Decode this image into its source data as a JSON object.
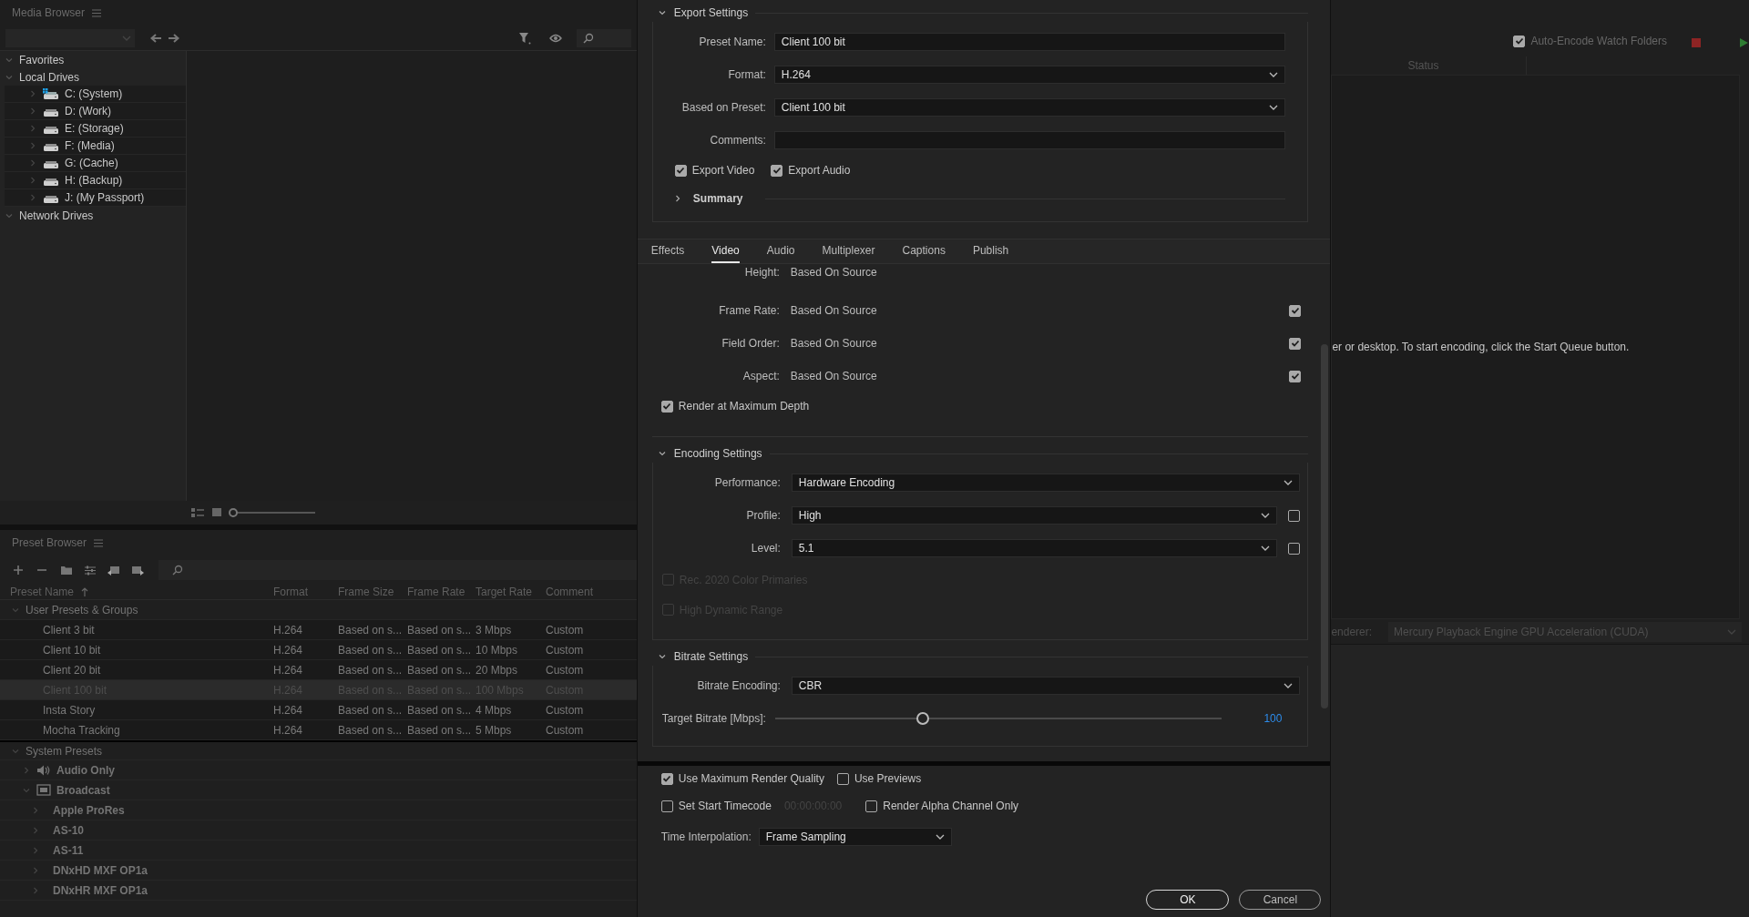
{
  "media_browser": {
    "title": "Media Browser",
    "zoom_slider": {
      "level": 0
    },
    "tree": [
      {
        "label": "Favorites",
        "expanded": true
      },
      {
        "label": "Local Drives",
        "expanded": true,
        "children": [
          {
            "label": "C: (System)",
            "kind": "system",
            "expanded": false
          },
          {
            "label": "D: (Work)",
            "kind": "drive",
            "expanded": false
          },
          {
            "label": "E: (Storage)",
            "kind": "drive",
            "expanded": false
          },
          {
            "label": "F: (Media)",
            "kind": "drive",
            "expanded": false
          },
          {
            "label": "G: (Cache)",
            "kind": "drive",
            "expanded": false
          },
          {
            "label": "H: (Backup)",
            "kind": "drive",
            "expanded": false
          },
          {
            "label": "J: (My Passport)",
            "kind": "drive",
            "expanded": false
          }
        ]
      },
      {
        "label": "Network Drives",
        "expanded": true
      }
    ]
  },
  "preset_browser": {
    "title": "Preset Browser",
    "columns": [
      {
        "label": "Preset Name",
        "sorted": true
      },
      {
        "label": "Format",
        "sorted": false
      },
      {
        "label": "Frame Size",
        "sorted": false
      },
      {
        "label": "Frame Rate",
        "sorted": false
      },
      {
        "label": "Target Rate",
        "sorted": false
      },
      {
        "label": "Comment",
        "sorted": false
      }
    ],
    "user_group": {
      "label": "User Presets & Groups",
      "expanded": true,
      "rows": [
        {
          "name": "Client 3 bit",
          "format": "H.264",
          "frame_size": "Based on s...",
          "frame_rate": "Based on s...",
          "target_rate": "3 Mbps",
          "comment": "Custom",
          "selected": false
        },
        {
          "name": "Client 10 bit",
          "format": "H.264",
          "frame_size": "Based on s...",
          "frame_rate": "Based on s...",
          "target_rate": "10 Mbps",
          "comment": "Custom",
          "selected": false
        },
        {
          "name": "Client 20 bit",
          "format": "H.264",
          "frame_size": "Based on s...",
          "frame_rate": "Based on s...",
          "target_rate": "20 Mbps",
          "comment": "Custom",
          "selected": false
        },
        {
          "name": "Client 100 bit",
          "format": "H.264",
          "frame_size": "Based on s...",
          "frame_rate": "Based on s...",
          "target_rate": "100 Mbps",
          "comment": "Custom",
          "selected": true
        },
        {
          "name": "Insta Story",
          "format": "H.264",
          "frame_size": "Based on s...",
          "frame_rate": "Based on s...",
          "target_rate": "4 Mbps",
          "comment": "Custom",
          "selected": false
        },
        {
          "name": "Mocha Tracking",
          "format": "H.264",
          "frame_size": "Based on s...",
          "frame_rate": "Based on s...",
          "target_rate": "5 Mbps",
          "comment": "Custom",
          "selected": false
        }
      ]
    },
    "system_group": {
      "label": "System Presets",
      "expanded": true,
      "children": [
        {
          "label": "Audio Only",
          "kind": "audio",
          "expanded": false
        },
        {
          "label": "Broadcast",
          "kind": "tv",
          "expanded": true,
          "children": [
            {
              "label": "Apple ProRes",
              "expanded": false
            },
            {
              "label": "AS-10",
              "expanded": false
            },
            {
              "label": "AS-11",
              "expanded": false
            },
            {
              "label": "DNxHD MXF OP1a",
              "expanded": false
            },
            {
              "label": "DNxHR MXF OP1a",
              "expanded": false
            }
          ]
        }
      ]
    }
  },
  "dialog": {
    "export_settings": {
      "title": "Export Settings",
      "expanded": true,
      "fields": [
        {
          "label": "Preset Name:",
          "kind": "text",
          "value": "Client 100 bit"
        },
        {
          "label": "Format:",
          "kind": "select",
          "value": "H.264"
        },
        {
          "label": "Based on Preset:",
          "kind": "select",
          "value": "Client 100 bit"
        },
        {
          "label": "Comments:",
          "kind": "text"
        }
      ],
      "checkboxes": [
        {
          "label": "Export Video",
          "checked": true
        },
        {
          "label": "Export Audio",
          "checked": true
        }
      ],
      "summary": {
        "label": "Summary",
        "expanded": false
      }
    },
    "tabs": [
      {
        "label": "Effects",
        "selected": false
      },
      {
        "label": "Video",
        "selected": true
      },
      {
        "label": "Audio",
        "selected": false
      },
      {
        "label": "Multiplexer",
        "selected": false
      },
      {
        "label": "Captions",
        "selected": false
      },
      {
        "label": "Publish",
        "selected": false
      }
    ],
    "video": {
      "height_row": {
        "label": "Height:",
        "value": "Based On Source"
      },
      "rows": [
        {
          "label": "Frame Rate:",
          "value": "Based On Source",
          "checked": true
        },
        {
          "label": "Field Order:",
          "value": "Based On Source",
          "checked": true
        },
        {
          "label": "Aspect:",
          "value": "Based On Source",
          "checked": true
        }
      ],
      "render_max_depth": {
        "label": "Render at Maximum Depth",
        "checked": true
      }
    },
    "encoding": {
      "title": "Encoding Settings",
      "expanded": true,
      "fields": [
        {
          "label": "Performance:",
          "kind": "select",
          "value": "Hardware Encoding"
        },
        {
          "label": "Profile:",
          "kind": "select",
          "value": "High",
          "checked": false
        },
        {
          "label": "Level:",
          "kind": "select",
          "value": "5.1",
          "checked": false
        }
      ],
      "checkboxes": [
        {
          "label": "Rec. 2020 Color Primaries",
          "checked": false,
          "disabled": true
        },
        {
          "label": "High Dynamic Range",
          "checked": false,
          "disabled": true
        }
      ]
    },
    "bitrate": {
      "title": "Bitrate Settings",
      "expanded": true,
      "fields": [
        {
          "label": "Bitrate Encoding:",
          "kind": "select",
          "value": "CBR"
        }
      ],
      "slider": {
        "label": "Target Bitrate [Mbps]:",
        "level": 0.33,
        "reading": "100"
      }
    },
    "options": [
      {
        "label": "Use Maximum Render Quality",
        "checked": true
      },
      {
        "label": "Use Previews",
        "checked": false
      }
    ],
    "timecode": {
      "label": "Set Start Timecode",
      "checked": false,
      "value": "00:00:00:00"
    },
    "alpha": {
      "label": "Render Alpha Channel Only",
      "checked": false
    },
    "time_interpolation": {
      "label": "Time Interpolation:",
      "value": "Frame Sampling"
    },
    "buttons": [
      {
        "label": "OK",
        "kind": "primary"
      },
      {
        "label": "Cancel",
        "kind": "secondary"
      }
    ]
  },
  "queue": {
    "auto_encode": {
      "label": "Auto-Encode Watch Folders",
      "checked": true
    },
    "columns": [
      "Status"
    ],
    "message": "er or desktop.  To start encoding, click the Start Queue button.",
    "renderer": {
      "label": "enderer:",
      "value": "Mercury Playback Engine GPU Acceleration (CUDA)"
    }
  }
}
